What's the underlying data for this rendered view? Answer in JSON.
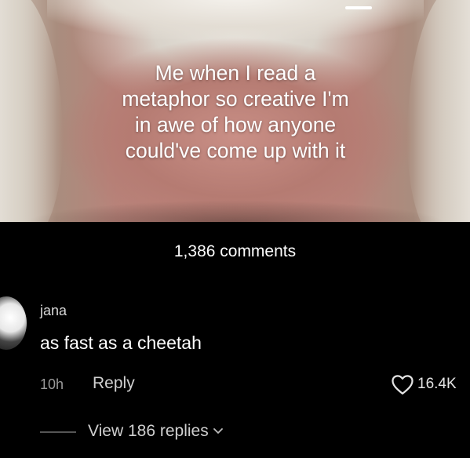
{
  "post": {
    "caption_lines": [
      "Me when I read a",
      "metaphor so creative I'm",
      "in awe of how anyone",
      "could've come up with it"
    ]
  },
  "comments_header": {
    "count_label": "1,386 comments"
  },
  "comment": {
    "username": "jana",
    "text": "as fast as a cheetah",
    "time": "10h",
    "reply_label": "Reply",
    "likes": "16.4K",
    "view_replies_label": "View 186 replies"
  },
  "icons": {
    "like": "heart-icon",
    "expand": "chevron-down-icon"
  }
}
